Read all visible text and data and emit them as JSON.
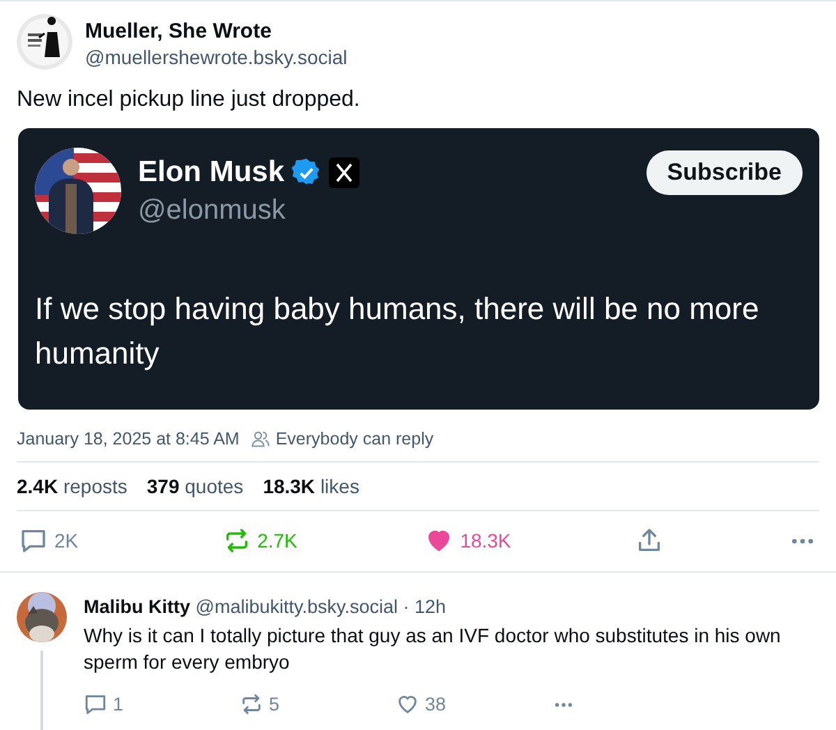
{
  "post": {
    "author": {
      "name": "Mueller, She Wrote",
      "handle": "@muellershewrote.bsky.social"
    },
    "text": "New incel pickup line just dropped.",
    "embed": {
      "kind": "picture",
      "name": "Elon Musk",
      "verified": true,
      "handle": "@elonmusk",
      "button": "Subscribe",
      "text": "If we stop having baby humans, there will be no more humanity"
    },
    "date": "January 18, 2025 at 8:45 AM",
    "reply_setting": "Everybody can reply",
    "stats": [
      {
        "count": "2.4K",
        "label": "reposts"
      },
      {
        "count": "379",
        "label": "quotes"
      },
      {
        "count": "18.3K",
        "label": "likes"
      }
    ],
    "actions": [
      {
        "kind": "reply",
        "count": "2K"
      },
      {
        "kind": "repost",
        "count": "2.7K",
        "on": true
      },
      {
        "kind": "like",
        "count": "18.3K",
        "on": true
      },
      {
        "kind": "share"
      },
      {
        "kind": "more"
      }
    ]
  },
  "reply": {
    "name": "Malibu Kitty",
    "handle": "@malibukitty.bsky.social",
    "time": "· 12h",
    "text": "Why is it can I totally picture that guy as an IVF doctor who substitutes in his own sperm for every embryo",
    "actions": [
      {
        "kind": "reply",
        "count": "1"
      },
      {
        "kind": "repost",
        "count": "5",
        "on": false
      },
      {
        "kind": "like",
        "count": "38",
        "on": false
      },
      {
        "kind": "more"
      }
    ]
  }
}
